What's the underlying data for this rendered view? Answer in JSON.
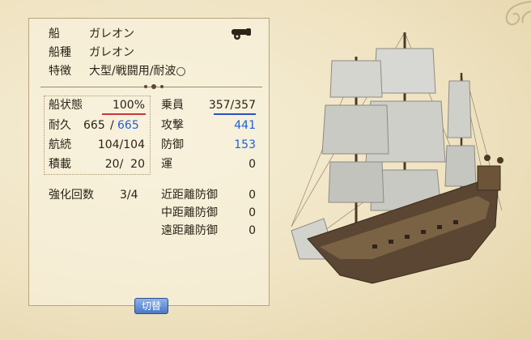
{
  "info": {
    "ship_label": "船",
    "ship_value": "ガレオン",
    "type_label": "船種",
    "type_value": "ガレオン",
    "feature_label": "特徴",
    "feature_value": "大型/戦闘用/耐波○"
  },
  "status": {
    "state_label": "船状態",
    "state_value": "100%",
    "durability_label": "耐久",
    "durability_current": "665",
    "durability_sep": "/",
    "durability_max": "665",
    "endurance_label": "航続",
    "endurance_value": "104/104",
    "cargo_label": "積載",
    "cargo_value": "20/  20"
  },
  "combat": {
    "crew_label": "乗員",
    "crew_value": "357/357",
    "attack_label": "攻撃",
    "attack_value": "441",
    "defense_label": "防御",
    "defense_value": "153",
    "luck_label": "運",
    "luck_value": "0"
  },
  "enhance": {
    "count_label": "強化回数",
    "count_value": "3/4",
    "near_label": "近距離防御",
    "near_value": "0",
    "mid_label": "中距離防御",
    "mid_value": "0",
    "far_label": "遠距離防御",
    "far_value": "0"
  },
  "buttons": {
    "switch_label": "切替"
  },
  "colors": {
    "blue_value": "#1f5fd6",
    "panel_bg": "#efe4c4"
  },
  "icons": [
    "cannon-icon",
    "ornament-icon",
    "corner-flourish",
    "galleon-ship"
  ]
}
